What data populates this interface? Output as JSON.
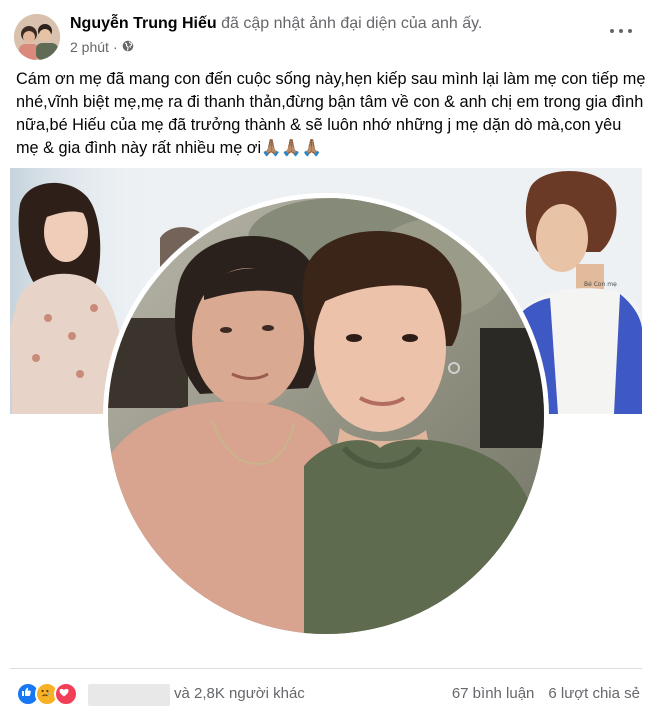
{
  "post": {
    "author_name": "Nguyễn Trung Hiếu",
    "action_text": "đã cập nhật ảnh đại diện của anh ấy.",
    "timestamp": "2 phút",
    "audience_icon": "globe-icon",
    "menu_icon": "more-horizontal-icon",
    "message": "Cám ơn mẹ đã mang con đến cuộc sống này,hẹn kiếp sau mình lại làm mẹ con tiếp mẹ nhé,vĩnh biệt mẹ,mẹ ra đi thanh thản,đừng bận tâm về con & anh chị em trong gia đình nữa,bé Hiếu của mẹ đã trưởng thành & sẽ luôn nhớ những j mẹ dặn dò mà,con yêu mẹ & gia đình này rất nhiều mẹ ơi🙏🏽🙏🏽🙏🏽"
  },
  "media": {
    "cover_tattoo_text": "Bé Con mẹ"
  },
  "stats": {
    "reaction_icons": [
      "like-icon",
      "sad-icon",
      "love-icon"
    ],
    "others_text": "và 2,8K người khác",
    "comments": "67 bình luận",
    "shares": "6 lượt chia sẻ"
  },
  "colors": {
    "like": "#1877f2",
    "sad": "#f7b125",
    "love": "#f33e58",
    "secondary_text": "#65676b"
  }
}
